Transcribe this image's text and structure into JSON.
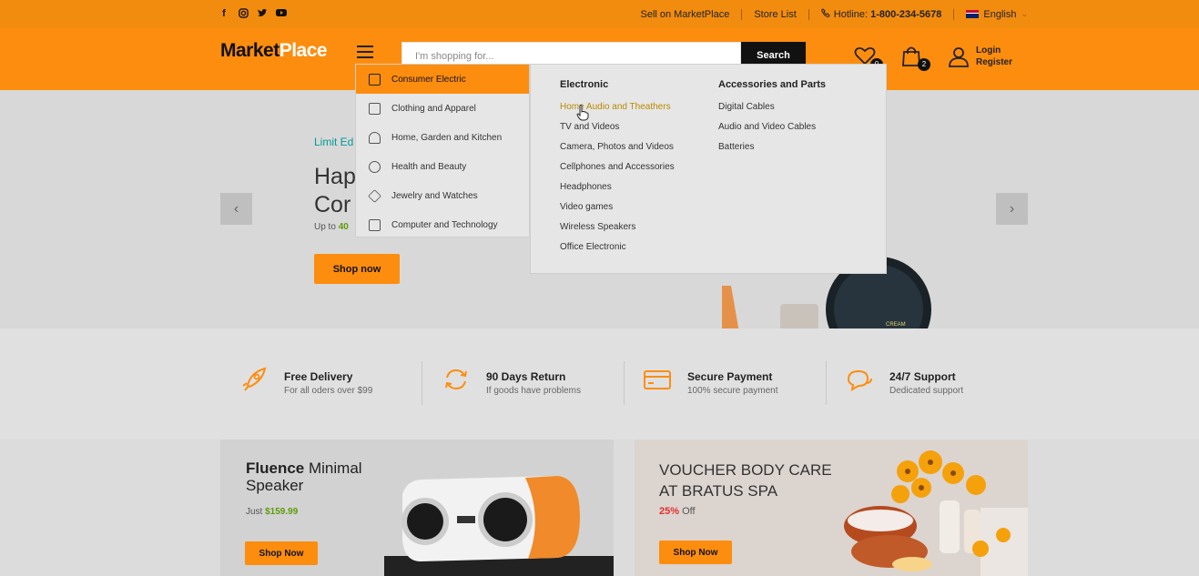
{
  "colors": {
    "brand": "#fd8d0e",
    "topbar": "#f28c0f",
    "hero_bg": "#d8d8d8",
    "teal": "#009a9a",
    "green_price": "#5d9c0a",
    "red": "#e52e2e",
    "dark": "#111111"
  },
  "topbar": {
    "social_icons": [
      "facebook-icon",
      "instagram-icon",
      "twitter-icon",
      "youtube-icon"
    ],
    "sell_link": "Sell on MarketPlace",
    "store_list": "Store List",
    "hotline_label": "Hotline:",
    "hotline_number": "1-800-234-5678",
    "language": "English"
  },
  "header": {
    "logo_part1": "Market",
    "logo_part2": "Place",
    "search_placeholder": "I'm shopping for...",
    "search_button": "Search",
    "wishlist_count": "0",
    "cart_count": "2",
    "login_label": "Login",
    "register_label": "Register"
  },
  "category_menu": {
    "items": [
      {
        "label": "Consumer Electric",
        "icon": "tablet-icon",
        "active": true
      },
      {
        "label": "Clothing and Apparel",
        "icon": "shirt-icon",
        "active": false
      },
      {
        "label": "Home, Garden and Kitchen",
        "icon": "lamp-icon",
        "active": false
      },
      {
        "label": "Health and Beauty",
        "icon": "heart-pulse-icon",
        "active": false
      },
      {
        "label": "Jewelry and Watches",
        "icon": "diamond-icon",
        "active": false
      },
      {
        "label": "Computer and Technology",
        "icon": "monitor-icon",
        "active": false
      }
    ]
  },
  "mega_menu": {
    "col1": {
      "heading": "Electronic",
      "links": [
        "Home Audio and Theathers",
        "TV and Videos",
        "Camera, Photos and Videos",
        "Cellphones and Accessories",
        "Headphones",
        "Video games",
        "Wireless Speakers",
        "Office Electronic"
      ]
    },
    "col2": {
      "heading": "Accessories and Parts",
      "links": [
        "Digital Cables",
        "Audio and Video Cables",
        "Batteries"
      ]
    }
  },
  "hero": {
    "eyebrow": "Limit Ed",
    "title_line1": "Hap",
    "title_line2": "Cor",
    "sub_prefix": "Up to",
    "sub_value": "40",
    "button": "Shop now",
    "product_label": "CREAM"
  },
  "features": [
    {
      "title": "Free Delivery",
      "sub": "For all oders over $99",
      "icon": "rocket-icon"
    },
    {
      "title": "90 Days Return",
      "sub": "If goods have problems",
      "icon": "refresh-icon"
    },
    {
      "title": "Secure Payment",
      "sub": "100% secure payment",
      "icon": "credit-card-icon"
    },
    {
      "title": "24/7 Support",
      "sub": "Dedicated support",
      "icon": "chat-bubbles-icon"
    }
  ],
  "promo1": {
    "title_bold": "Fluence",
    "title_rest": "Minimal",
    "title_line2": "Speaker",
    "price_prefix": "Just",
    "price": "$159.99",
    "button": "Shop Now"
  },
  "promo2": {
    "title_line1": "VOUCHER BODY CARE",
    "title_line2": "AT BRATUS SPA",
    "discount": "25%",
    "discount_suffix": "Off",
    "button": "Shop Now"
  }
}
